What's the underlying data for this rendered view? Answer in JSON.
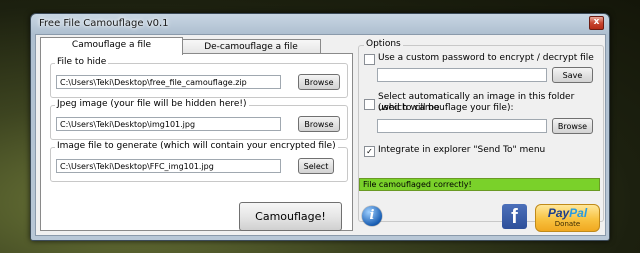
{
  "window": {
    "title": "Free File Camouflage v0.1",
    "close_glyph": "x"
  },
  "tabs": [
    {
      "label": "Camouflage a file"
    },
    {
      "label": "De-camouflage a file"
    }
  ],
  "file_to_hide": {
    "label": "File to hide",
    "value": "C:\\Users\\Teki\\Desktop\\free_file_camouflage.zip",
    "button": "Browse"
  },
  "jpeg_image": {
    "label": "Jpeg image (your file will be hidden here!)",
    "value": "C:\\Users\\Teki\\Desktop\\img101.jpg",
    "button": "Browse"
  },
  "output_image": {
    "label": "Image file to generate (which will contain your encrypted file)",
    "value": "C:\\Users\\Teki\\Desktop\\FFC_img101.jpg",
    "button": "Select"
  },
  "camouflage_button": "Camouflage!",
  "options": {
    "title": "Options",
    "custom_password": {
      "label": "Use a custom password to encrypt / decrypt file",
      "checked": false,
      "value": "",
      "button": "Save"
    },
    "auto_select": {
      "label_line1": "Select automatically an image in this folder (which will be",
      "label_line2": "used to camouflage your file):",
      "checked": false,
      "value": "",
      "button": "Browse"
    },
    "send_to": {
      "label": "Integrate in explorer \"Send To\" menu",
      "checked": true,
      "check_glyph": "✓"
    }
  },
  "status": {
    "text": "File camouflaged correctly!",
    "color": "#7ad12a"
  },
  "icons": {
    "info": "i",
    "facebook": "f"
  },
  "paypal": {
    "pay": "Pay",
    "pal": "Pal",
    "sub": "Donate"
  }
}
